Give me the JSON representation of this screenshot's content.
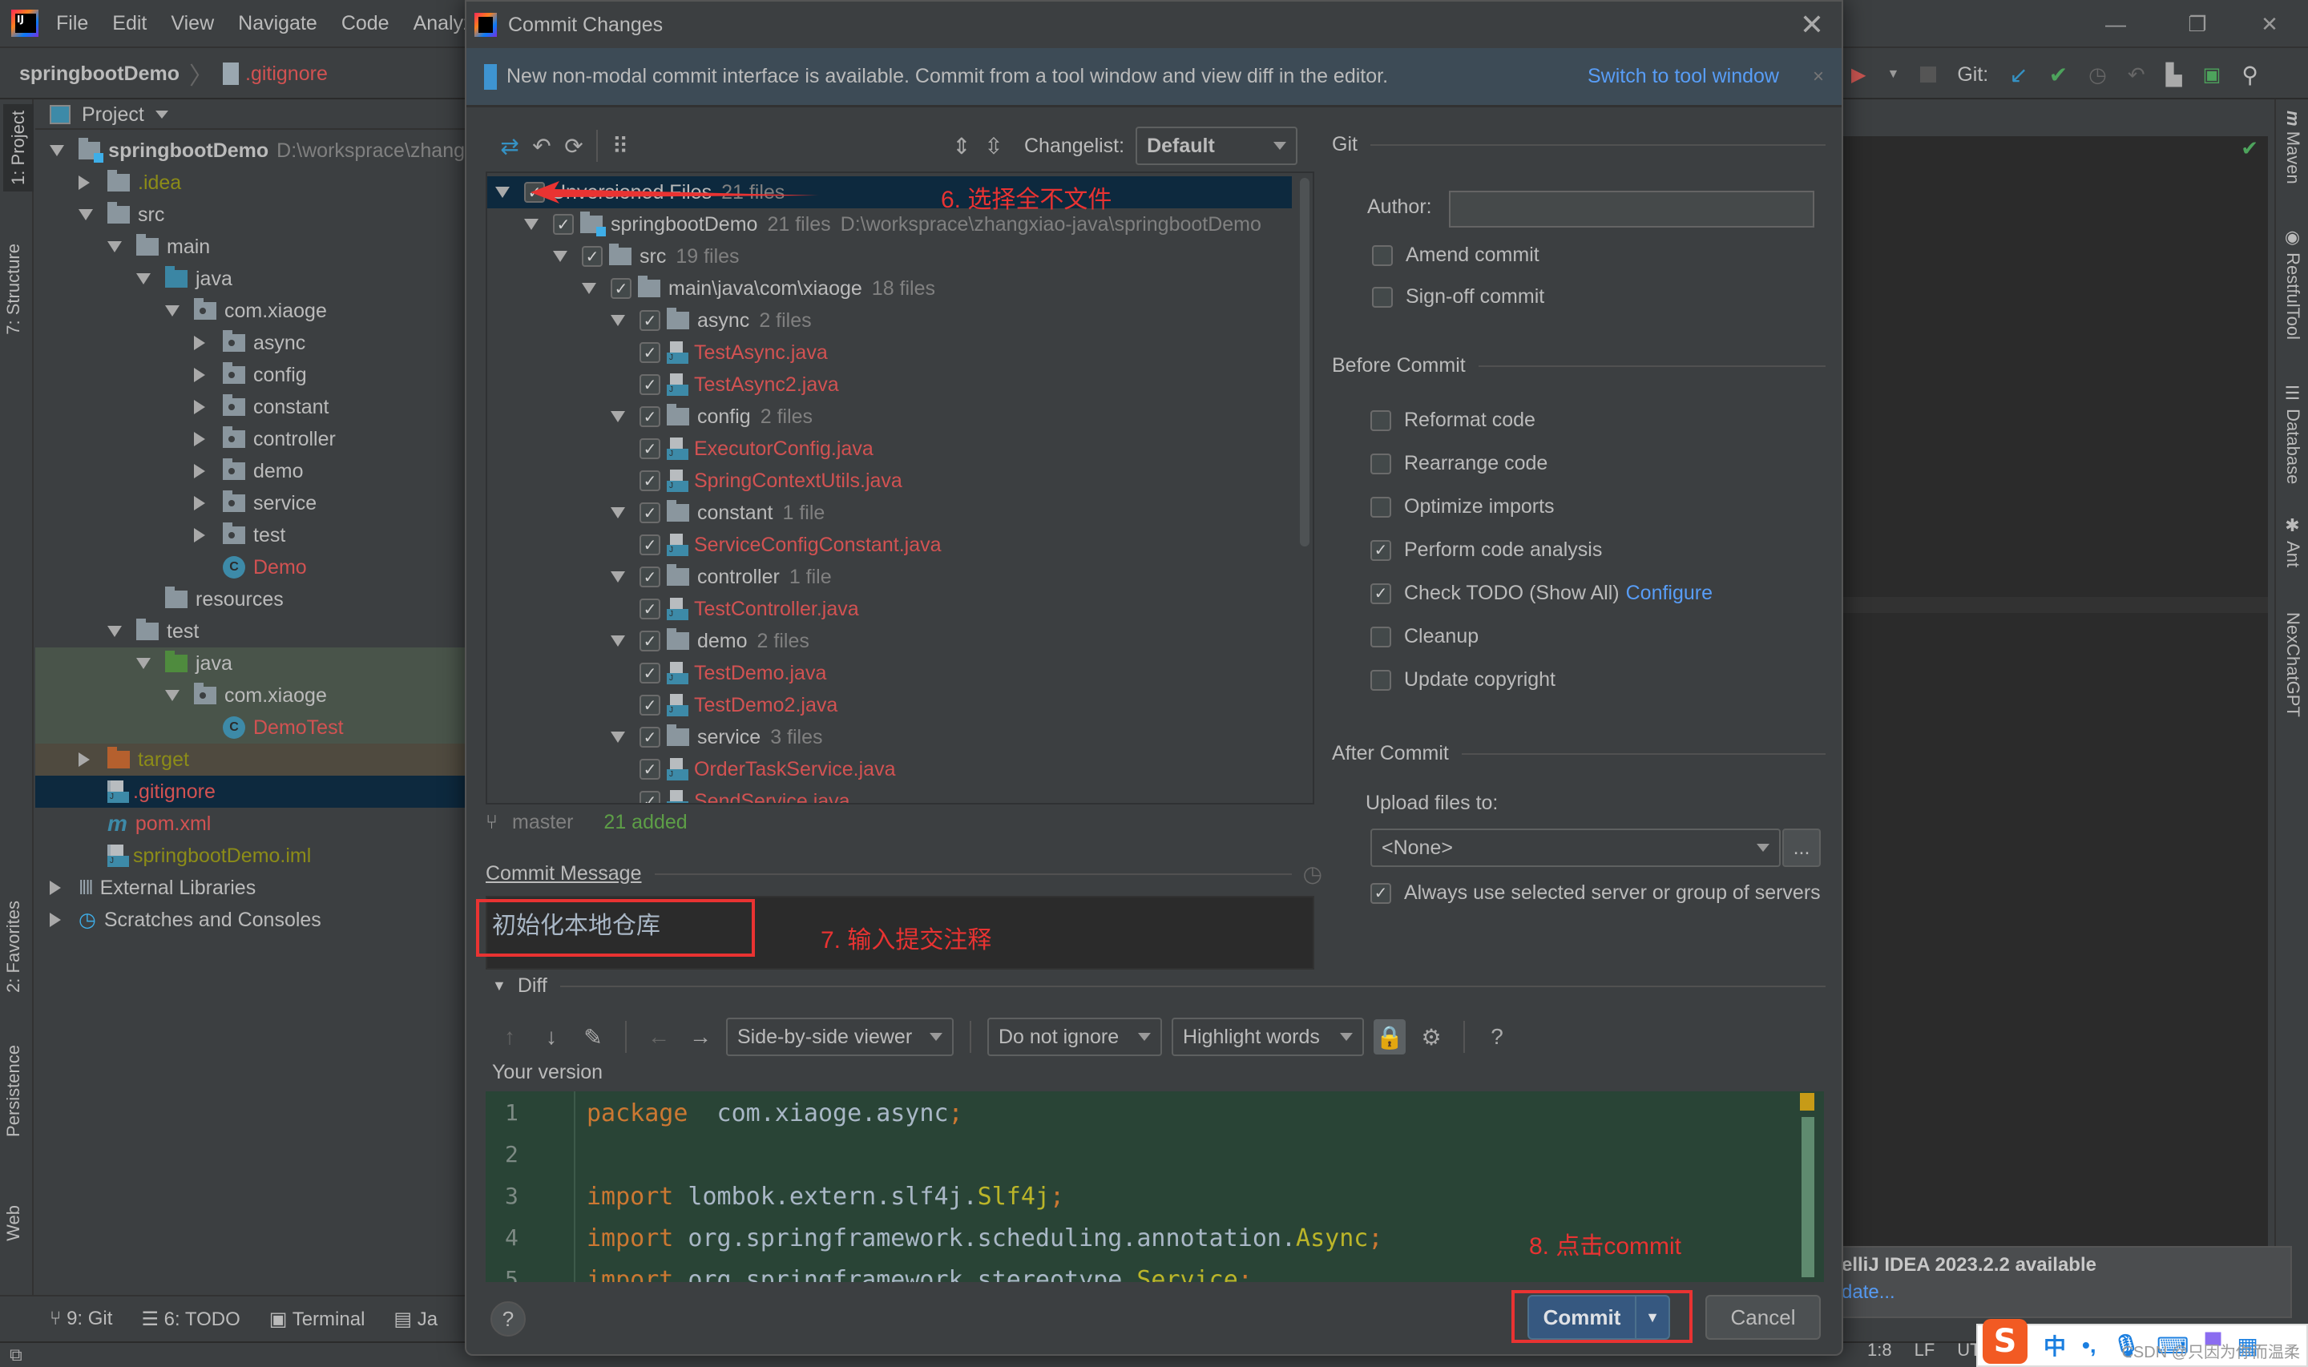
{
  "ide": {
    "menu": [
      "File",
      "Edit",
      "View",
      "Navigate",
      "Code",
      "Analyz"
    ],
    "breadcrumb": {
      "project": "springbootDemo",
      "file": ".gitignore"
    },
    "window_controls": {
      "minimize": "—",
      "restore": "❐",
      "close": "✕"
    },
    "toolbar": {
      "git_label": "Git:"
    },
    "left_tabs": [
      "1: Project",
      "7: Structure",
      "2: Favorites",
      "Persistence",
      "Web"
    ],
    "right_tabs": [
      "Maven",
      "RestfulTool",
      "Database",
      "Ant",
      "NexChatGPT"
    ],
    "project_panel": {
      "title": "Project",
      "tree": [
        {
          "label": "springbootDemo",
          "extra": "D:\\worksprace\\zhang",
          "level": 0,
          "state": "open",
          "icon": "module-folder",
          "bold": true
        },
        {
          "label": ".idea",
          "level": 1,
          "state": "closed",
          "icon": "folder",
          "color": "olive"
        },
        {
          "label": "src",
          "level": 1,
          "state": "open",
          "icon": "folder"
        },
        {
          "label": "main",
          "level": 2,
          "state": "open",
          "icon": "folder"
        },
        {
          "label": "java",
          "level": 3,
          "state": "open",
          "icon": "folder-blue"
        },
        {
          "label": "com.xiaoge",
          "level": 4,
          "state": "open",
          "icon": "package"
        },
        {
          "label": "async",
          "level": 5,
          "state": "closed",
          "icon": "package"
        },
        {
          "label": "config",
          "level": 5,
          "state": "closed",
          "icon": "package"
        },
        {
          "label": "constant",
          "level": 5,
          "state": "closed",
          "icon": "package"
        },
        {
          "label": "controller",
          "level": 5,
          "state": "closed",
          "icon": "package"
        },
        {
          "label": "demo",
          "level": 5,
          "state": "closed",
          "icon": "package"
        },
        {
          "label": "service",
          "level": 5,
          "state": "closed",
          "icon": "package"
        },
        {
          "label": "test",
          "level": 5,
          "state": "closed",
          "icon": "package"
        },
        {
          "label": "Demo",
          "level": 5,
          "state": "leaf",
          "icon": "spring-class",
          "color": "red"
        },
        {
          "label": "resources",
          "level": 3,
          "state": "leaf",
          "icon": "folder-resources"
        },
        {
          "label": "test",
          "level": 2,
          "state": "open",
          "icon": "folder"
        },
        {
          "label": "java",
          "level": 3,
          "state": "open",
          "icon": "folder-green",
          "highlight": "test"
        },
        {
          "label": "com.xiaoge",
          "level": 4,
          "state": "open",
          "icon": "package",
          "highlight": "test"
        },
        {
          "label": "DemoTest",
          "level": 5,
          "state": "leaf",
          "icon": "test-class",
          "color": "red",
          "highlight": "test"
        },
        {
          "label": "target",
          "level": 1,
          "state": "closed",
          "icon": "folder-orange",
          "color": "olive",
          "highlight": "excluded"
        },
        {
          "label": ".gitignore",
          "level": 1,
          "state": "leaf",
          "icon": "ignore-file",
          "color": "red",
          "selected": true
        },
        {
          "label": "pom.xml",
          "level": 1,
          "state": "leaf",
          "icon": "maven",
          "color": "red"
        },
        {
          "label": "springbootDemo.iml",
          "level": 1,
          "state": "leaf",
          "icon": "iml-file",
          "color": "olive"
        },
        {
          "label": "External Libraries",
          "level": 0,
          "state": "closed",
          "icon": "libraries"
        },
        {
          "label": "Scratches and Consoles",
          "level": 0,
          "state": "closed",
          "icon": "scratches"
        }
      ]
    },
    "bottom_tabs": [
      "9: Git",
      "6: TODO",
      "Terminal",
      "Ja"
    ],
    "status": {
      "position": "1:8",
      "line_ending": "LF",
      "encoding": "UTF"
    },
    "notification": {
      "title": "elliJ IDEA 2023.2.2 available",
      "link": "date..."
    },
    "ime": {
      "logo": "S",
      "mode": "中",
      "punct": "•,",
      "watermark": "CSDN @只因为你而温柔"
    }
  },
  "dialog": {
    "title": "Commit Changes",
    "banner": {
      "text": "New non-modal commit interface is available. Commit from a tool window and view diff in the editor.",
      "link": "Switch to tool window",
      "close": "×"
    },
    "changelist": {
      "label": "Changelist:",
      "value": "Default"
    },
    "files": [
      {
        "label": "Unversioned Files",
        "count": "21 files",
        "level": 0,
        "type": "group",
        "checked": true,
        "selected": true
      },
      {
        "label": "springbootDemo",
        "count": "21 files",
        "path": "D:\\worksprace\\zhangxiao-java\\springbootDemo",
        "level": 1,
        "type": "module",
        "checked": true
      },
      {
        "label": "src",
        "count": "19 files",
        "level": 2,
        "type": "folder",
        "checked": true
      },
      {
        "label": "main\\java\\com\\xiaoge",
        "count": "18 files",
        "level": 3,
        "type": "folder",
        "checked": true
      },
      {
        "label": "async",
        "count": "2 files",
        "level": 4,
        "type": "folder",
        "checked": true
      },
      {
        "label": "TestAsync.java",
        "level": 5,
        "type": "java",
        "checked": true
      },
      {
        "label": "TestAsync2.java",
        "level": 5,
        "type": "java",
        "checked": true
      },
      {
        "label": "config",
        "count": "2 files",
        "level": 4,
        "type": "folder",
        "checked": true
      },
      {
        "label": "ExecutorConfig.java",
        "level": 5,
        "type": "java",
        "checked": true
      },
      {
        "label": "SpringContextUtils.java",
        "level": 5,
        "type": "java",
        "checked": true
      },
      {
        "label": "constant",
        "count": "1 file",
        "level": 4,
        "type": "folder",
        "checked": true
      },
      {
        "label": "ServiceConfigConstant.java",
        "level": 5,
        "type": "java",
        "checked": true
      },
      {
        "label": "controller",
        "count": "1 file",
        "level": 4,
        "type": "folder",
        "checked": true
      },
      {
        "label": "TestController.java",
        "level": 5,
        "type": "java",
        "checked": true
      },
      {
        "label": "demo",
        "count": "2 files",
        "level": 4,
        "type": "folder",
        "checked": true
      },
      {
        "label": "TestDemo.java",
        "level": 5,
        "type": "java",
        "checked": true
      },
      {
        "label": "TestDemo2.java",
        "level": 5,
        "type": "java",
        "checked": true
      },
      {
        "label": "service",
        "count": "3 files",
        "level": 4,
        "type": "folder",
        "checked": true
      },
      {
        "label": "OrderTaskService.java",
        "level": 5,
        "type": "java",
        "checked": true
      },
      {
        "label": "SendService.java",
        "level": 5,
        "type": "java",
        "checked": true
      }
    ],
    "branch": {
      "name": "master",
      "summary": "21 added"
    },
    "git_section": {
      "title": "Git",
      "author_label": "Author:",
      "author_value": "",
      "options": [
        {
          "label": "Amend commit",
          "checked": false
        },
        {
          "label": "Sign-off commit",
          "checked": false
        }
      ]
    },
    "before_commit": {
      "title": "Before Commit",
      "options": [
        {
          "label": "Reformat code",
          "checked": false
        },
        {
          "label": "Rearrange code",
          "checked": false
        },
        {
          "label": "Optimize imports",
          "checked": false
        },
        {
          "label": "Perform code analysis",
          "checked": true
        },
        {
          "label": "Check TODO (Show All)",
          "checked": true,
          "link": "Configure"
        },
        {
          "label": "Cleanup",
          "checked": false
        },
        {
          "label": "Update copyright",
          "checked": false
        }
      ]
    },
    "after_commit": {
      "title": "After Commit",
      "upload_label": "Upload files to:",
      "upload_value": "<None>",
      "browse": "...",
      "always_use": {
        "label": "Always use selected server or group of servers",
        "checked": true
      }
    },
    "commit_message": {
      "label": "Commit Message",
      "value": "初始化本地仓库"
    },
    "diff": {
      "label": "Diff",
      "viewer": "Side-by-side viewer",
      "ignore": "Do not ignore",
      "highlight": "Highlight words",
      "help": "?",
      "version_label": "Your version",
      "lines": [
        {
          "n": "1",
          "parts": [
            [
              "kw",
              "package"
            ],
            [
              "",
              "  com.xiaoge.async"
            ],
            [
              "kw",
              ";"
            ]
          ]
        },
        {
          "n": "2",
          "parts": []
        },
        {
          "n": "3",
          "parts": [
            [
              "kw",
              "import"
            ],
            [
              "",
              " lombok.extern.slf4j."
            ],
            [
              "cls",
              "Slf4j"
            ],
            [
              "kw",
              ";"
            ]
          ]
        },
        {
          "n": "4",
          "parts": [
            [
              "kw",
              "import"
            ],
            [
              "",
              " org.springframework.scheduling.annotation."
            ],
            [
              "cls",
              "Async"
            ],
            [
              "kw",
              ";"
            ]
          ]
        },
        {
          "n": "5",
          "parts": [
            [
              "kw",
              "import"
            ],
            [
              "",
              " org.springframework.stereotype."
            ],
            [
              "cls",
              "Service"
            ],
            [
              "kw",
              ";"
            ]
          ]
        }
      ]
    },
    "buttons": {
      "help": "?",
      "commit": "Commit",
      "cancel": "Cancel"
    }
  },
  "annotations": {
    "step6": "6. 选择全不文件",
    "step7": "7. 输入提交注释",
    "step8": "8. 点击commit"
  },
  "colors": {
    "accent_blue": "#589df6",
    "unversioned_red": "#d25252",
    "added_green": "#5d9e47",
    "annotation_red": "#e93332",
    "commit_button": "#365880"
  }
}
